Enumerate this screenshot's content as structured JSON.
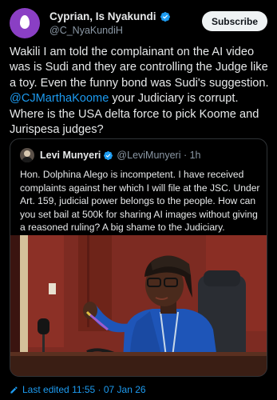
{
  "author": {
    "display_name": "Cyprian, Is Nyakundi",
    "handle": "@C_NyaKundiH",
    "avatar_color": "#8a3fc4"
  },
  "subscribe_label": "Subscribe",
  "tweet": {
    "text_1": "Wakili I am told the complainant on the AI video was is Sudi and they are controlling  the Judge like a toy. Even the funny bond was Sudi's suggestion. ",
    "mention": "@CJMarthaKoome",
    "text_2": " your Judiciary is corrupt. Where is the USA delta force to pick Koome and Jurispesa judges?"
  },
  "quoted": {
    "display_name": "Levi Munyeri",
    "handle": "@LeviMunyeri",
    "separator": " · ",
    "time": "1h",
    "text": "Hon. Dolphina Alego is incompetent. I have received complaints against her which I will file at the JSC. Under Art. 159, judicial power belongs to the people. How can you set bail at 500k for sharing AI images without giving a reasoned ruling? A big shame to the Judiciary."
  },
  "footer": {
    "edited_label": "Last edited",
    "time": "11:55",
    "separator": " · ",
    "date": "07 Jan 26"
  },
  "colors": {
    "background": "#000000",
    "text": "#e7e9ea",
    "secondary": "#8b98a5",
    "accent": "#1d9bf0",
    "verified": "#1d9bf0"
  },
  "icons": {
    "verified": "verified-badge-icon",
    "edit": "pencil-icon"
  }
}
